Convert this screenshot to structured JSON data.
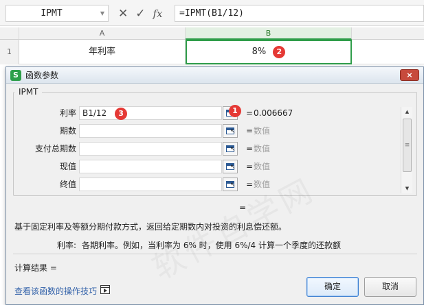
{
  "formula_bar": {
    "name_box": "IPMT",
    "cancel_icon": "close-x-icon",
    "confirm_icon": "check-icon",
    "fx_label": "fx",
    "formula": "=IPMT(B1/12)"
  },
  "sheet": {
    "columns": [
      "A",
      "B"
    ],
    "selected_column": "B",
    "row_number": "1",
    "cells": {
      "A1": "年利率",
      "B1": "8%"
    },
    "badge_b1": "2"
  },
  "dialog": {
    "title": "函数参数",
    "app_icon_letter": "S",
    "close_label": "×",
    "function_name": "IPMT",
    "params": [
      {
        "label": "利率",
        "input": "B1/12",
        "badge": "3",
        "ref_badge": "1",
        "eq": "=",
        "value": "0.006667"
      },
      {
        "label": "期数",
        "input": "",
        "eq": "=",
        "value": "数值"
      },
      {
        "label": "支付总期数",
        "input": "",
        "eq": "=",
        "value": "数值"
      },
      {
        "label": "现值",
        "input": "",
        "eq": "=",
        "value": "数值"
      },
      {
        "label": "终值",
        "input": "",
        "eq": "=",
        "value": "数值"
      }
    ],
    "result_eq": "=",
    "description": "基于固定利率及等额分期付款方式，返回给定期数内对投资的利息偿还额。",
    "param_desc_name": "利率:",
    "param_desc_text": "各期利率。例如，当利率为 6% 时，使用 6%/4 计算一个季度的还款额",
    "calc_result": "计算结果 =",
    "tips_link": "查看该函数的操作技巧",
    "ok_label": "确定",
    "cancel_label": "取消"
  },
  "watermark": "软件自学网",
  "colors": {
    "accent_green": "#2f9d4a",
    "badge_red": "#e53935",
    "link_blue": "#2f5fa8",
    "close_red": "#c74a3c"
  }
}
